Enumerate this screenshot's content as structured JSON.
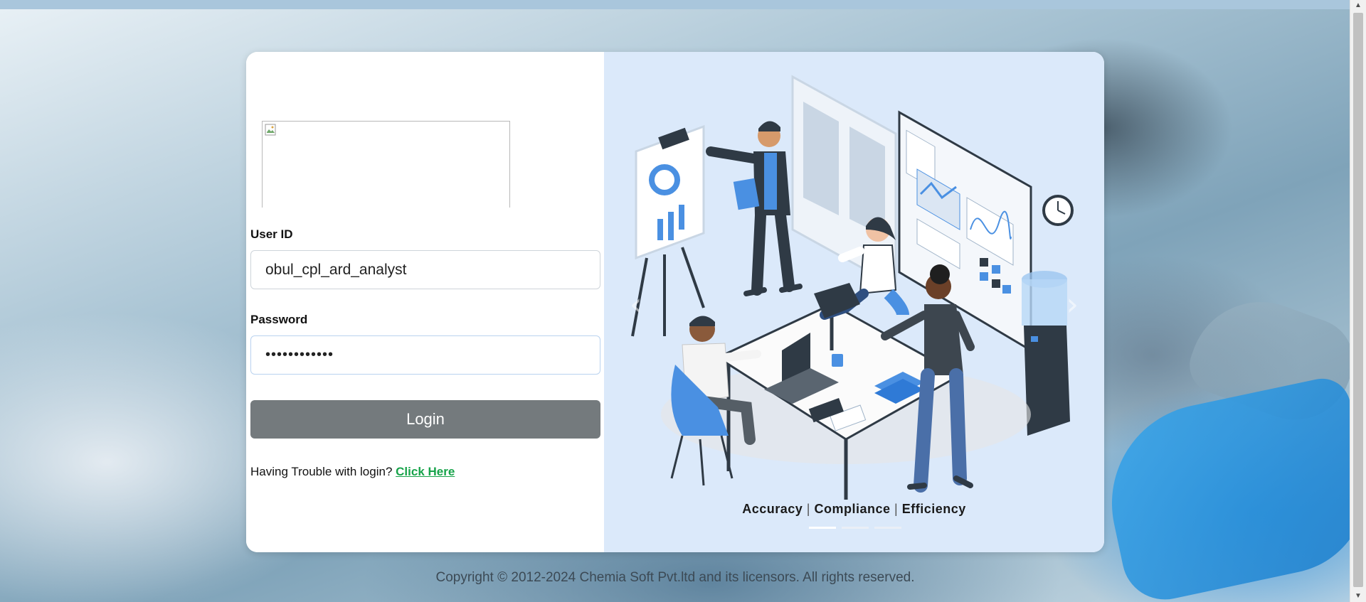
{
  "form": {
    "user_id_label": "User ID",
    "user_id_value": "obul_cpl_ard_analyst",
    "password_label": "Password",
    "password_value": "••••••••••••",
    "login_label": "Login",
    "trouble_text": "Having Trouble with login?",
    "trouble_link": "Click Here"
  },
  "carousel": {
    "tagline_1": "Accuracy",
    "tagline_sep_1": "|",
    "tagline_2": "Compliance",
    "tagline_sep_2": "|",
    "tagline_3": "Efficiency",
    "slide_count": 3,
    "active_slide": 1
  },
  "footer": {
    "copyright": "Copyright © 2012-2024 Chemia Soft Pvt.ltd and its licensors. All rights reserved."
  },
  "colors": {
    "login_button": "#747a7d",
    "link": "#17a34a",
    "panel_bg": "#dbe9fa",
    "accent_blue": "#4a90e2"
  }
}
